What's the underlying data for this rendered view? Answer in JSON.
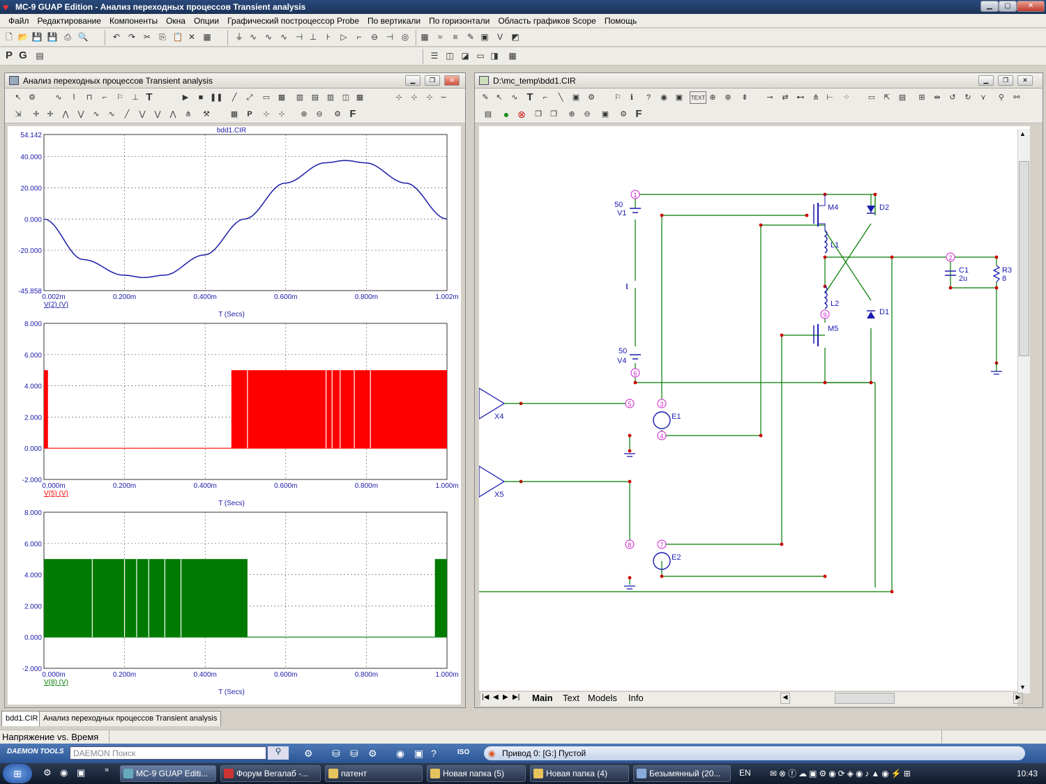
{
  "window": {
    "title": "MC-9 GUAP Edition - Анализ переходных процессов Transient analysis"
  },
  "menu": [
    "Файл",
    "Редактирование",
    "Компоненты",
    "Окна",
    "Опции",
    "Графический построцессор Probe",
    "По вертикали",
    "По горизонтали",
    "Область графиков Scope",
    "Помощь"
  ],
  "toolbar2": {
    "p": "P",
    "g": "G"
  },
  "transient_window": {
    "title": "Анализ переходных процессов Transient analysis",
    "f_label": "F"
  },
  "schematic_window": {
    "title": "D:\\mc_temp\\bdd1.CIR",
    "text_btn": "TEXT",
    "f_label": "F",
    "sheet_tabs": [
      "Main",
      "Text",
      "Models",
      "Info"
    ]
  },
  "colors": {
    "trace1": "#1a1aa8",
    "trace2": "#ff0000",
    "trace3": "#007a00",
    "wire": "#007a00",
    "node": "#d020d0",
    "part": "#1a1ab0",
    "dot": "#cc0000"
  },
  "chart_data": [
    {
      "type": "line",
      "title": "bdd1.CIR",
      "xlabel": "T (Secs)",
      "ylabel": "V(2) (V)",
      "ylim": [
        -45.858,
        54.142
      ],
      "yticks": [
        "54.142",
        "40.000",
        "20.000",
        "0.000",
        "-20.000",
        "-45.858"
      ],
      "xticks": [
        "0.002m",
        "0.200m",
        "0.400m",
        "0.600m",
        "0.800m",
        "1.002m"
      ],
      "x_ms": [
        0.002,
        0.1,
        0.2,
        0.25,
        0.3,
        0.4,
        0.5,
        0.6,
        0.7,
        0.75,
        0.8,
        0.9,
        1.002
      ],
      "y": [
        0,
        -26,
        -36,
        -37.5,
        -36,
        -23,
        0,
        23,
        36,
        37.5,
        36,
        23,
        0
      ]
    },
    {
      "type": "area",
      "xlabel": "T (Secs)",
      "ylabel": "V(5) (V)",
      "ylim": [
        -2,
        8
      ],
      "yticks": [
        "8.000",
        "6.000",
        "4.000",
        "2.000",
        "0.000",
        "-2.000"
      ],
      "xticks": [
        "0.000m",
        "0.200m",
        "0.400m",
        "0.600m",
        "0.800m",
        "1.000m"
      ],
      "high_level": 5,
      "high_intervals_ms": [
        [
          0,
          0.01
        ],
        [
          0.465,
          1.0
        ]
      ]
    },
    {
      "type": "area",
      "xlabel": "T (Secs)",
      "ylabel": "V(8) (V)",
      "ylim": [
        -2,
        8
      ],
      "yticks": [
        "8.000",
        "6.000",
        "4.000",
        "2.000",
        "0.000",
        "-2.000"
      ],
      "xticks": [
        "0.000m",
        "0.200m",
        "0.400m",
        "0.600m",
        "0.800m",
        "1.000m"
      ],
      "high_level": 5,
      "high_intervals_ms": [
        [
          0,
          0.505
        ],
        [
          0.97,
          1.0
        ]
      ]
    }
  ],
  "circuit_labels": {
    "v1_val": "50",
    "v1": "V1",
    "v4_val": "50",
    "v4": "V4",
    "m4": "M4",
    "m5": "M5",
    "d1": "D1",
    "d2": "D2",
    "l1": "L1",
    "l2": "L2",
    "c1": "C1",
    "c1_val": "2u",
    "r3": "R3",
    "r3_val": "8",
    "e1": "E1",
    "e2": "E2",
    "x4": "X4",
    "x5": "X5",
    "n1": "1",
    "n2": "2",
    "n3": "3",
    "n4": "4",
    "n5": "5",
    "n6": "6",
    "n7": "7",
    "n8": "8",
    "n9": "9"
  },
  "doc_tabs": [
    "bdd1.CIR",
    "Анализ переходных процессов Transient analysis"
  ],
  "status": {
    "text": "Напряжение vs. Время"
  },
  "daemon": {
    "logo": "DAEMON TOOLS",
    "search_placeholder": "DAEMON Поиск",
    "drive": "Привод 0: [G:] Пустой",
    "iso": "ISO"
  },
  "taskbar": {
    "tasks": [
      "MC-9 GUAP Editi...",
      "Форум Вегалаб -...",
      "патент",
      "Новая папка (5)",
      "Новая папка (4)",
      "Безымянный (20..."
    ],
    "lang": "EN",
    "clock": "10:43"
  }
}
